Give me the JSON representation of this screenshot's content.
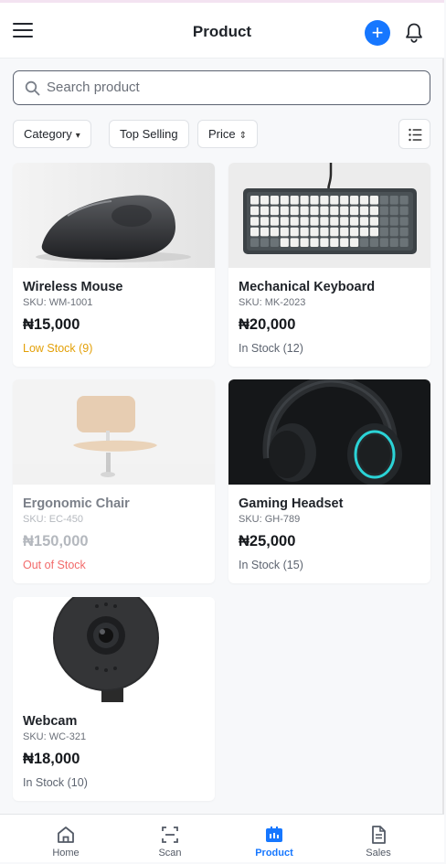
{
  "header": {
    "title": "Product",
    "add_symbol": "+",
    "menu_icon": "hamburger-icon",
    "notification_icon": "bell-icon"
  },
  "search": {
    "placeholder": "Search product",
    "value": ""
  },
  "filters": [
    {
      "label": "Category",
      "indicator": "▾"
    },
    {
      "label": "Top Selling"
    },
    {
      "label": "Price",
      "indicator": "⇕"
    }
  ],
  "view_toggle": {
    "icon": "list-view-icon"
  },
  "products": [
    {
      "name": "Wireless Mouse",
      "sku": "SKU: WM-1001",
      "price": "₦15,000",
      "stock": "Low Stock (9)",
      "status": "low"
    },
    {
      "name": "Mechanical Keyboard",
      "sku": "SKU: MK-2023",
      "price": "₦20,000",
      "stock": "In Stock (12)",
      "status": "in"
    },
    {
      "name": "Ergonomic Chair",
      "sku": "SKU: EC-450",
      "price": "₦150,000",
      "stock": "Out of Stock",
      "status": "out"
    },
    {
      "name": "Gaming Headset",
      "sku": "SKU: GH-789",
      "price": "₦25,000",
      "stock": "In Stock (15)",
      "status": "in"
    },
    {
      "name": "Webcam",
      "sku": "SKU: WC-321",
      "price": "₦18,000",
      "stock": "In Stock (10)",
      "status": "in"
    }
  ],
  "bottom_nav": [
    {
      "label": "Home",
      "icon": "home-icon",
      "active": false
    },
    {
      "label": "Scan",
      "icon": "scan-icon",
      "active": false
    },
    {
      "label": "Product",
      "icon": "product-icon",
      "active": true
    },
    {
      "label": "Sales",
      "icon": "sales-icon",
      "active": false
    }
  ],
  "colors": {
    "accent": "#1677ff",
    "low_stock": "#e3a008",
    "out_of_stock": "#f26b6b",
    "background": "#f7f8fa"
  }
}
